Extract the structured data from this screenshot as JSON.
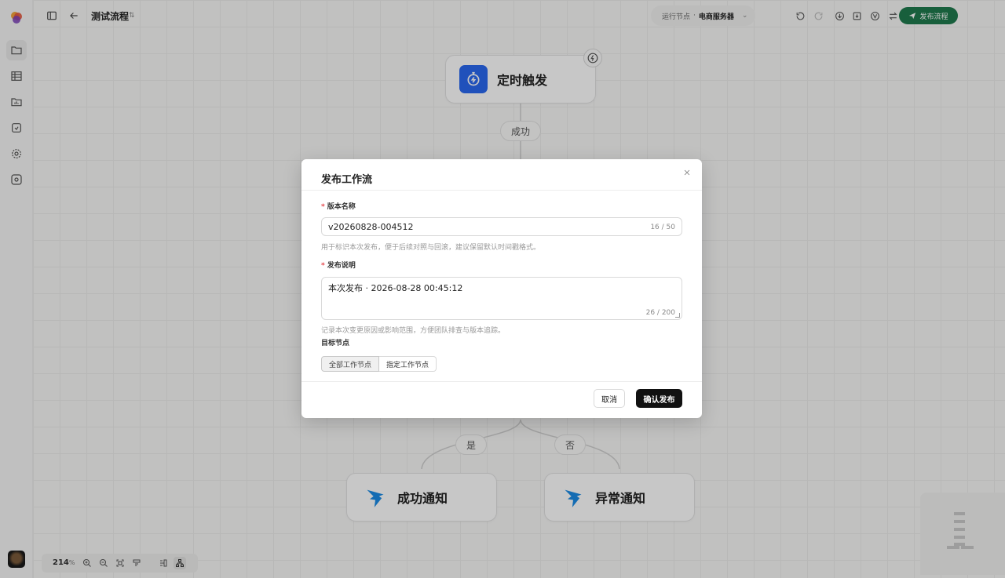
{
  "topbar": {
    "flow_title": "测试流程",
    "run_node_label": "运行节点",
    "run_node_value": "电商服务器",
    "publish_label": "发布流程"
  },
  "flow": {
    "trigger_title": "定时触发",
    "edge_success": "成功",
    "edge_yes": "是",
    "edge_no": "否",
    "success_notify_title": "成功通知",
    "error_notify_title": "异常通知"
  },
  "zoom": {
    "value": "214",
    "unit": "%"
  },
  "modal": {
    "title": "发布工作流",
    "version_label": "版本名称",
    "version_value": "v20260828-004512",
    "version_counter": "16 / 50",
    "version_help": "用于标识本次发布，便于后续对照与回滚，建议保留默认时间戳格式。",
    "desc_label": "发布说明",
    "desc_value": "本次发布 · 2026-08-28 00:45:12",
    "desc_counter": "26 / 200",
    "desc_help": "记录本次变更原因或影响范围，方便团队排查与版本追踪。",
    "target_label": "目标节点",
    "target_options": [
      "全部工作节点",
      "指定工作节点"
    ],
    "target_selected": "全部工作节点",
    "cancel_label": "取消",
    "confirm_label": "确认发布"
  },
  "colors": {
    "publish_green": "#1f7a4d",
    "trigger_blue": "#2a68f0",
    "dingtalk_blue": "#1a8be6",
    "confirm_black": "#111111",
    "required_red": "#e5484d"
  },
  "icons": {
    "sidebar": [
      "folder-icon",
      "table-icon",
      "folder-chart-icon",
      "checkbox-icon",
      "settings-icon",
      "gear-gallery-icon"
    ],
    "topbar": [
      "layout-sidebar-icon",
      "back-arrow-icon",
      "undo-icon",
      "redo-icon",
      "download-icon",
      "import-icon",
      "verify-icon",
      "swap-icon"
    ]
  }
}
